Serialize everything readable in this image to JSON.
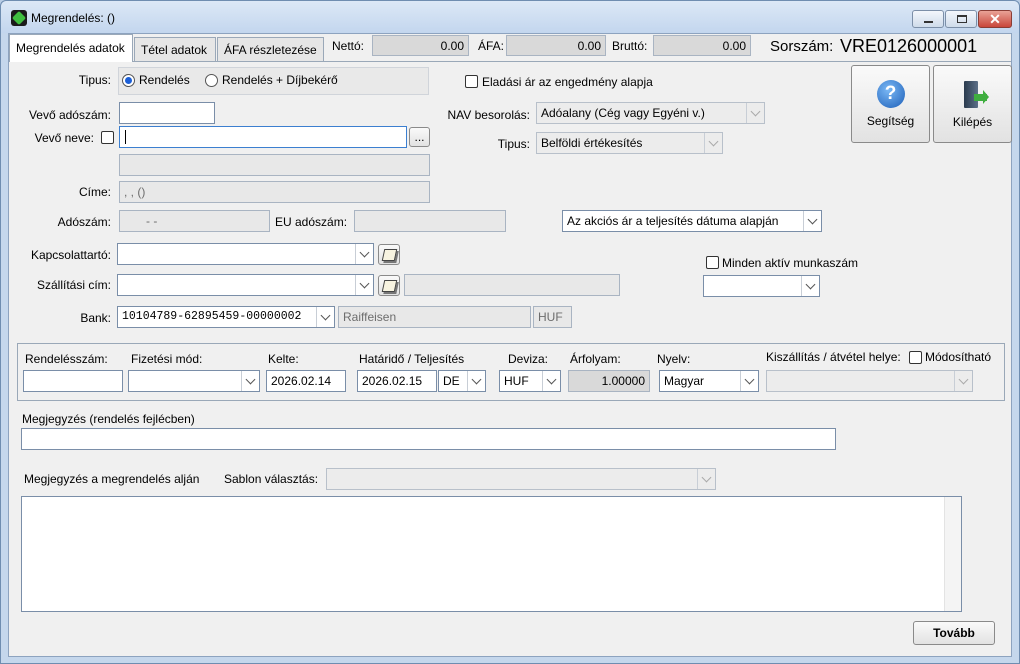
{
  "window": {
    "title": "Megrendelés: ()",
    "controls": [
      "minimize",
      "maximize",
      "close"
    ]
  },
  "tabs": [
    {
      "label": "Megrendelés adatok",
      "active": true
    },
    {
      "label": "Tétel adatok",
      "active": false
    },
    {
      "label": "ÁFA részletezése",
      "active": false
    }
  ],
  "totals": {
    "netto_label": "Nettó:",
    "netto_value": "0.00",
    "afa_label": "ÁFA:",
    "afa_value": "0.00",
    "brutto_label": "Bruttó:",
    "brutto_value": "0.00",
    "sorszam_label": "Sorszám:",
    "sorszam_value": "VRE0126000001"
  },
  "type": {
    "label": "Tipus:",
    "options": [
      "Rendelés",
      "Rendelés + Díjbekérő"
    ],
    "selected": "Rendelés"
  },
  "customer": {
    "tax_label": "Vevő adószám:",
    "tax_value": "",
    "name_label": "Vevő neve:",
    "name_value": "",
    "browse_label": "...",
    "name2_value": "",
    "address_label": "Címe:",
    "address_value": ", ,  ()",
    "adoszam_label": "Adószám:",
    "adoszam_value": "- -",
    "eu_label": "EU adószám:",
    "eu_value": ""
  },
  "right_options": {
    "discount_label": "Eladási ár az engedmény alapja",
    "nav_label": "NAV besorolás:",
    "nav_value": "Adóalany (Cég vagy Egyéni v.)",
    "type2_label": "Tipus:",
    "type2_value": "Belföldi értékesítés",
    "promo_value": "Az akciós ár a teljesítés dátuma alapján",
    "all_jobs_label": "Minden aktív munkaszám",
    "job_value": ""
  },
  "buttons": {
    "help_label": "Segítség",
    "exit_label": "Kilépés",
    "next_label": "Tovább"
  },
  "contacts": {
    "contact_label": "Kapcsolattartó:",
    "contact_value": "",
    "shipping_label": "Szállítási cím:",
    "shipping_value": "",
    "shipping_detail": "",
    "bank_label": "Bank:",
    "bank_value": "10104789-62895459-00000002",
    "bank_name": "Raiffeisen",
    "bank_currency": "HUF"
  },
  "order": {
    "number_label": "Rendelésszám:",
    "number_value": "",
    "payment_label": "Fizetési mód:",
    "payment_value": "",
    "date_label": "Kelte:",
    "date_value": "2026.02.14",
    "deadline_label": "Határidő / Teljesítés",
    "deadline_value": "2026.02.15",
    "ampm_value": "DE",
    "currency_label": "Deviza:",
    "currency_value": "HUF",
    "rate_label": "Árfolyam:",
    "rate_value": "1.00000",
    "language_label": "Nyelv:",
    "language_value": "Magyar",
    "delivery_label": "Kiszállítás / átvétel helye:",
    "modifiable_label": "Módosítható",
    "delivery_value": ""
  },
  "notes": {
    "header_note_label": "Megjegyzés (rendelés fejlécben)",
    "header_note_value": "",
    "footer_note_label": "Megjegyzés a megrendelés alján",
    "template_label": "Sablon választás:",
    "template_value": "",
    "footer_note_value": ""
  },
  "colors": {
    "accent": "#1c5fd6",
    "help_icon": "#2f7fd8",
    "exit_icon_green": "#3fae3f",
    "close_button": "#c9463a"
  }
}
